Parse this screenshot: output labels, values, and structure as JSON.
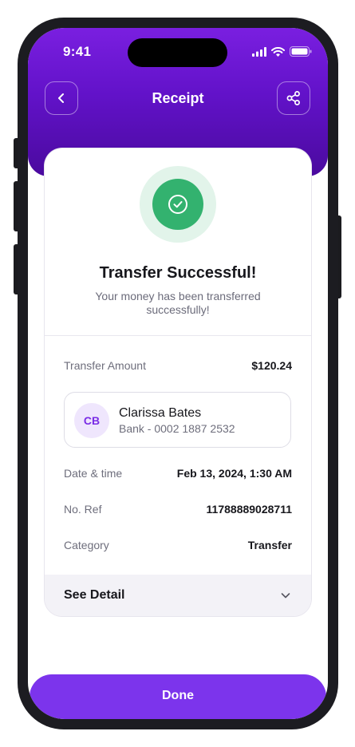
{
  "status_bar": {
    "time": "9:41"
  },
  "header": {
    "title": "Receipt"
  },
  "success": {
    "title": "Transfer Successful!",
    "subtitle": "Your money has been transferred successfully!"
  },
  "amount": {
    "label": "Transfer Amount",
    "value": "$120.24"
  },
  "recipient": {
    "initials": "CB",
    "name": "Clarissa Bates",
    "bank": "Bank - 0002 1887 2532"
  },
  "details": [
    {
      "label": "Date & time",
      "value": "Feb 13, 2024, 1:30 AM"
    },
    {
      "label": "No. Ref",
      "value": "11788889028711"
    },
    {
      "label": "Category",
      "value": "Transfer"
    }
  ],
  "see_detail": {
    "label": "See Detail"
  },
  "done": {
    "label": "Done"
  },
  "colors": {
    "accent": "#7c34ec",
    "header_gradient_top": "#7a1fe0",
    "header_gradient_bottom": "#4a0a9e",
    "success_green": "#33b26f"
  },
  "icons": [
    "back-chevron-icon",
    "share-icon",
    "check-icon",
    "chevron-down-icon",
    "cellular-icon",
    "wifi-icon",
    "battery-icon"
  ]
}
